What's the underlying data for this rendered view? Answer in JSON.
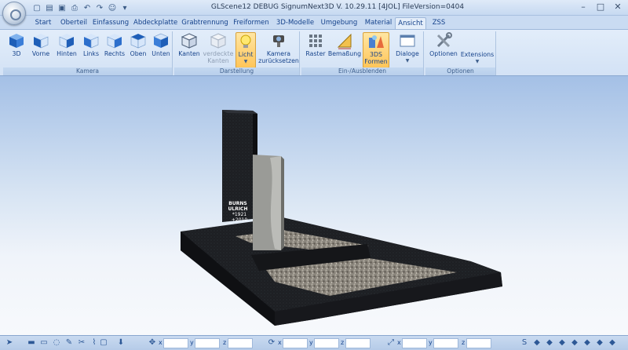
{
  "window": {
    "title": "GLScene12 DEBUG SignumNext3D V. 10.29.11 [4JOL] FileVersion=0404"
  },
  "qat_icons": [
    "new-file-icon",
    "open-folder-icon",
    "save-icon",
    "print-icon",
    "undo-icon",
    "redo-icon",
    "user-icon",
    "customize-icon"
  ],
  "tabs": [
    {
      "label": "Start"
    },
    {
      "label": "Oberteil"
    },
    {
      "label": "Einfassung"
    },
    {
      "label": "Abdeckplatte"
    },
    {
      "label": "Grabtrennung"
    },
    {
      "label": "Freiformen"
    },
    {
      "label": "3D-Modelle"
    },
    {
      "label": "Umgebung"
    },
    {
      "label": "Material"
    },
    {
      "label": "Ansicht",
      "active": true
    },
    {
      "label": "ZSS"
    }
  ],
  "ribbon": {
    "groups": [
      {
        "label": "Kamera",
        "buttons": [
          {
            "label": "3D",
            "icon": "cube-3d-icon"
          },
          {
            "label": "Vorne",
            "icon": "cube-front-icon"
          },
          {
            "label": "Hinten",
            "icon": "cube-back-icon"
          },
          {
            "label": "Links",
            "icon": "cube-left-icon"
          },
          {
            "label": "Rechts",
            "icon": "cube-right-icon"
          },
          {
            "label": "Oben",
            "icon": "cube-top-icon"
          },
          {
            "label": "Unten",
            "icon": "cube-bottom-icon"
          }
        ]
      },
      {
        "label": "Darstellung",
        "buttons": [
          {
            "label": "Kanten",
            "icon": "edges-icon"
          },
          {
            "label": "verdeckte Kanten",
            "icon": "hidden-edges-icon",
            "disabled": true
          },
          {
            "label": "Licht",
            "icon": "light-bulb-icon",
            "pressed": true,
            "dropdown": true
          },
          {
            "label": "Kamera zurücksetzen",
            "icon": "camera-reset-icon"
          }
        ]
      },
      {
        "label": "Ein-/Ausblenden",
        "buttons": [
          {
            "label": "Raster",
            "icon": "grid-icon"
          },
          {
            "label": "Bemaßung",
            "icon": "dimension-icon"
          },
          {
            "label": "3DS Formen",
            "icon": "3ds-shapes-icon",
            "pressed": true
          },
          {
            "label": "Dialoge",
            "icon": "dialogs-icon",
            "dropdown": true
          }
        ]
      },
      {
        "label": "Optionen",
        "buttons": [
          {
            "label": "Optionen",
            "icon": "tools-icon"
          },
          {
            "label": "Extensions",
            "icon": "extensions-icon",
            "dropdown": true
          }
        ]
      }
    ]
  },
  "scene": {
    "inscription": [
      "BURNS",
      "ULRICH",
      "*1921",
      "+2010"
    ],
    "colors": {
      "granite": "#1b1d21",
      "stone": "#9a9b97",
      "gravel": "#7e7a72",
      "sky_top": "#a4c0e6"
    }
  },
  "statusbar": {
    "axis_labels": [
      "x",
      "y",
      "z",
      "x",
      "y",
      "z",
      "x",
      "y",
      "z"
    ],
    "values": [
      "",
      "",
      "",
      "",
      "",
      "",
      "",
      "",
      ""
    ]
  }
}
